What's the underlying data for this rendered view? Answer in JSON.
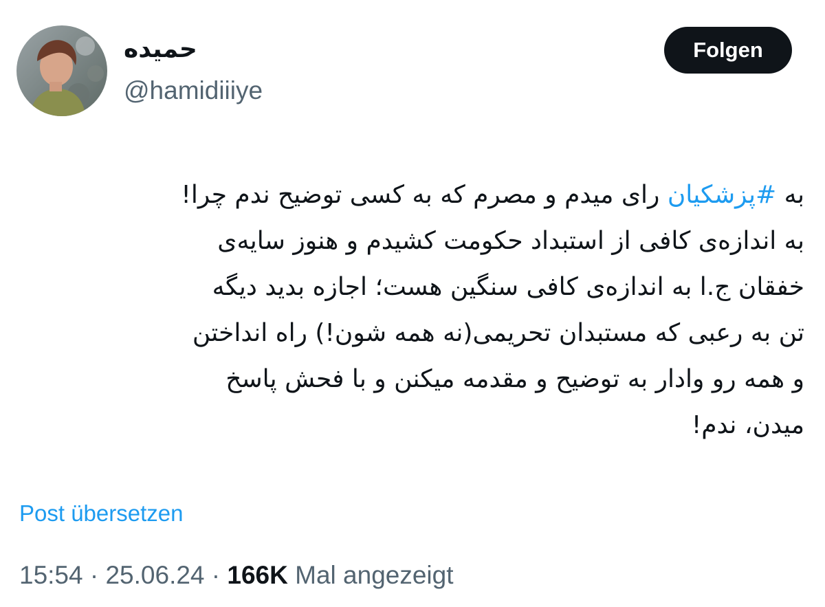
{
  "author": {
    "display_name": "حمیده",
    "handle": "@hamidiiiye"
  },
  "follow_button": {
    "label": "Folgen"
  },
  "tweet": {
    "lines": [
      {
        "before": "به ",
        "hashtag": "#پزشکیان",
        "after": " رای میدم و مصرم که به کسی توضیح ندم چرا!"
      },
      {
        "text": "به اندازه‌ی کافی از استبداد حکومت کشیدم و هنوز سایه‌ی"
      },
      {
        "text": "خفقان ج.ا به اندازه‌ی کافی سنگین هست؛ اجازه بدید دیگه"
      },
      {
        "text": "تن به رعبی که مستبدان تحریمی(نه همه شون!) راه انداختن"
      },
      {
        "text": "و همه رو وادار به توضیح و مقدمه میکنن و با فحش پاسخ"
      },
      {
        "text": "میدن، ندم!"
      }
    ]
  },
  "translate_link": "Post übersetzen",
  "meta": {
    "time": "15:54",
    "separator": "·",
    "date": "25.06.24",
    "views_count": "166K",
    "views_label": "Mal angezeigt"
  },
  "colors": {
    "accent": "#1d9bf0",
    "text_primary": "#0f1419",
    "text_secondary": "#536471",
    "button_bg": "#0f1419"
  }
}
